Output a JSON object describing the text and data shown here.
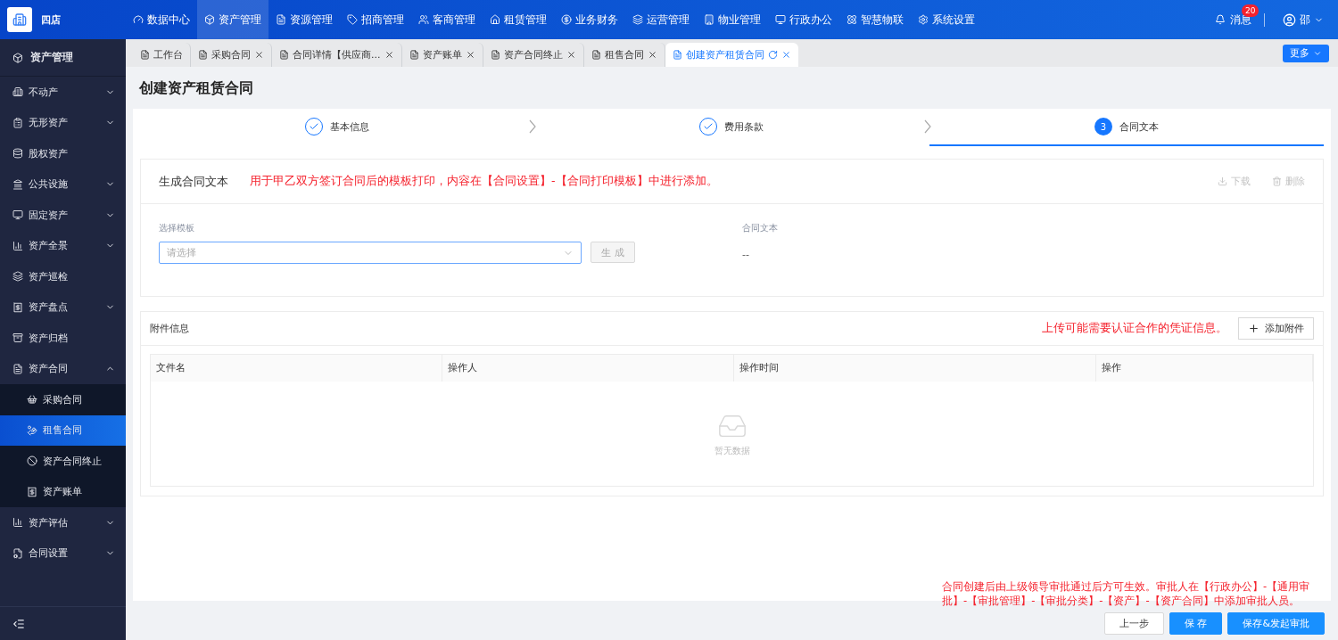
{
  "app": {
    "name": "四店"
  },
  "top_nav": [
    {
      "label": "数据中心",
      "selected": false
    },
    {
      "label": "资产管理",
      "selected": true
    },
    {
      "label": "资源管理",
      "selected": false
    },
    {
      "label": "招商管理",
      "selected": false
    },
    {
      "label": "客商管理",
      "selected": false
    },
    {
      "label": "租赁管理",
      "selected": false
    },
    {
      "label": "业务财务",
      "selected": false
    },
    {
      "label": "运营管理",
      "selected": false
    },
    {
      "label": "物业管理",
      "selected": false
    },
    {
      "label": "行政办公",
      "selected": false
    },
    {
      "label": "智慧物联",
      "selected": false
    },
    {
      "label": "系统设置",
      "selected": false
    }
  ],
  "header_right": {
    "messages": "消息",
    "badge": "20",
    "user": "邵"
  },
  "sidebar": {
    "title": "资产管理",
    "items": [
      {
        "label": "不动产",
        "expanded": false,
        "selected": false
      },
      {
        "label": "无形资产",
        "expanded": false,
        "selected": false
      },
      {
        "label": "股权资产",
        "selected": false
      },
      {
        "label": "公共设施",
        "expanded": false,
        "selected": false
      },
      {
        "label": "固定资产",
        "expanded": false,
        "selected": false
      },
      {
        "label": "资产全景",
        "expanded": false,
        "selected": false
      },
      {
        "label": "资产巡检",
        "selected": false
      },
      {
        "label": "资产盘点",
        "expanded": false,
        "selected": false
      },
      {
        "label": "资产归档",
        "selected": false
      },
      {
        "label": "资产合同",
        "expanded": true,
        "selected": false,
        "children": [
          {
            "label": "采购合同",
            "selected": false
          },
          {
            "label": "租售合同",
            "selected": true
          },
          {
            "label": "资产合同终止",
            "selected": false
          },
          {
            "label": "资产账单",
            "selected": false
          }
        ]
      },
      {
        "label": "资产评估",
        "expanded": false,
        "selected": false
      },
      {
        "label": "合同设置",
        "expanded": false,
        "selected": false
      }
    ]
  },
  "tabs": [
    {
      "label": "工作台",
      "selected": false,
      "closable": false
    },
    {
      "label": "采购合同",
      "selected": false,
      "closable": true
    },
    {
      "label": "合同详情【供应商...",
      "selected": false,
      "closable": true
    },
    {
      "label": "资产账单",
      "selected": false,
      "closable": true
    },
    {
      "label": "资产合同终止",
      "selected": false,
      "closable": true
    },
    {
      "label": "租售合同",
      "selected": false,
      "closable": true
    },
    {
      "label": "创建资产租赁合同",
      "selected": true,
      "closable": true
    }
  ],
  "more_button": "更多",
  "page_title": "创建资产租赁合同",
  "steps": [
    {
      "label": "基本信息",
      "done": true
    },
    {
      "label": "费用条款",
      "done": true
    },
    {
      "label": "合同文本",
      "done": false,
      "number": "3"
    }
  ],
  "contract_text": {
    "title": "生成合同文本",
    "note": "用于甲乙双方签订合同后的模板打印，内容在【合同设置】-【合同打印模板】中进行添加。",
    "actions": [
      {
        "label": "下载",
        "kind": "download",
        "disabled": true
      },
      {
        "label": "删除",
        "kind": "delete",
        "disabled": true
      }
    ],
    "template_label": "选择模板",
    "template_placeholder": "请选择",
    "generate_button": {
      "label": "生 成",
      "disabled": true
    },
    "text_label": "合同文本",
    "text_value": "--"
  },
  "attachments": {
    "title": "附件信息",
    "note": "上传可能需要认证合作的凭证信息。",
    "add_button": "添加附件",
    "columns": [
      "文件名",
      "操作人",
      "操作时间",
      "操作"
    ],
    "empty_text": "暂无数据"
  },
  "footer_note": "合同创建后由上级领导审批通过后方可生效。审批人在【行政办公】-【通用审批】-【审批管理】-【审批分类】-【资产】-【资产合同】中添加审批人员。",
  "buttons": [
    {
      "label": "上一步",
      "kind": "default"
    },
    {
      "label": "保 存",
      "kind": "primary"
    },
    {
      "label": "保存&发起审批",
      "kind": "primary"
    }
  ]
}
